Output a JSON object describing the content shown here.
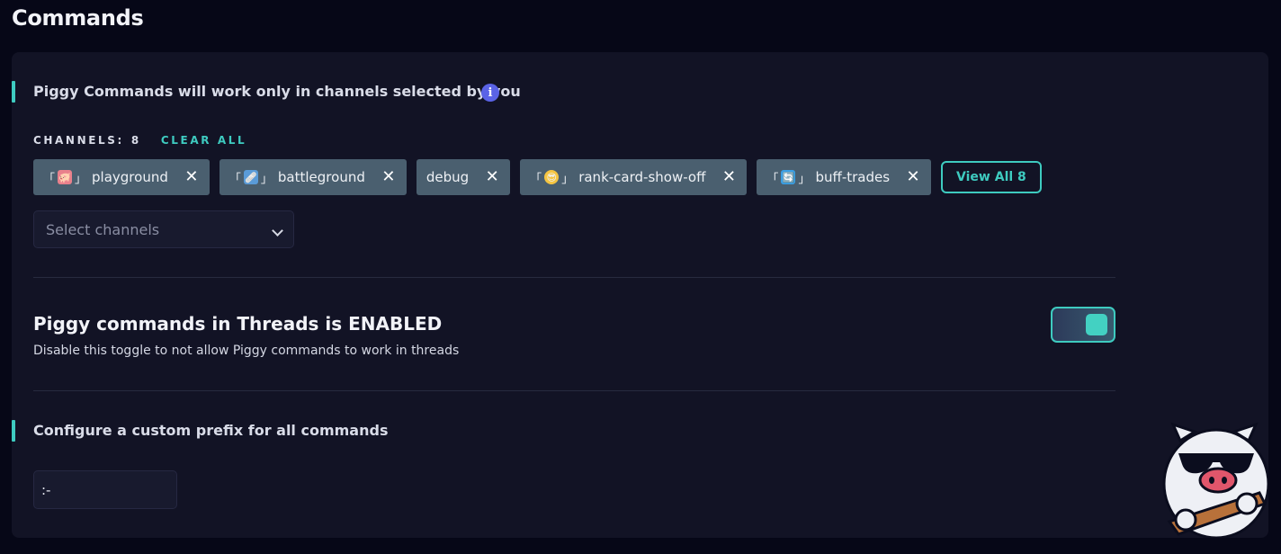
{
  "page": {
    "title": "Commands"
  },
  "channels_section": {
    "heading": "Piggy Commands will work only in channels selected by you",
    "info_icon": "info-icon",
    "count_label": "CHANNELS:",
    "count_value": "8",
    "clear_all_label": "CLEAR ALL",
    "chips": [
      {
        "bracket_open": "「",
        "emoji": "🐖",
        "bracket_close": "」",
        "name": "playground"
      },
      {
        "bracket_open": "「",
        "emoji": "🩹",
        "bracket_close": "」",
        "name": "battleground"
      },
      {
        "bracket_open": "",
        "emoji": "",
        "bracket_close": "",
        "name": "debug"
      },
      {
        "bracket_open": "「",
        "emoji": "😎",
        "bracket_close": "」",
        "name": "rank-card-show-off"
      },
      {
        "bracket_open": "「",
        "emoji": "🔄",
        "bracket_close": "」",
        "name": "buff-trades"
      }
    ],
    "remove_glyph": "✕",
    "view_all_label": "View All 8",
    "select_placeholder": "Select channels"
  },
  "threads_section": {
    "title": "Piggy commands in Threads is ENABLED",
    "description": "Disable this toggle to not allow Piggy commands to work in threads",
    "toggle_on": true
  },
  "prefix_section": {
    "heading": "Configure a custom prefix for all commands",
    "value": ":-"
  },
  "colors": {
    "background": "#060717",
    "card": "#121325",
    "accent": "#3ecbc0",
    "chip": "#4a5f6f",
    "info": "#5a63e6"
  }
}
